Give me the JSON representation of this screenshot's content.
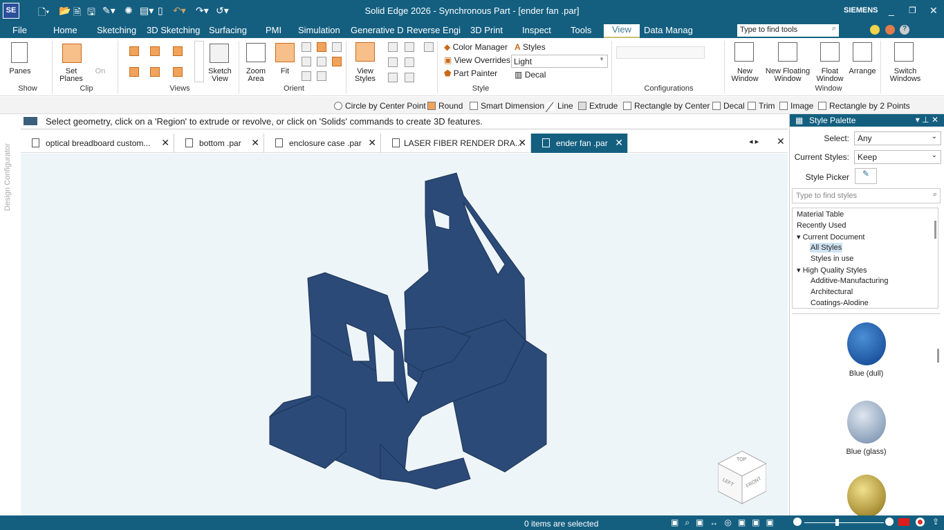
{
  "app": {
    "logo": "SE",
    "title": "Solid Edge 2026 - Synchronous Part - [ender fan .par]",
    "brand": "SIEMENS",
    "window_controls": [
      "_",
      "❐",
      "✕"
    ]
  },
  "menu_tabs": [
    "File",
    "Home",
    "Sketching",
    "3D Sketching",
    "Surfacing",
    "PMI",
    "Simulation",
    "Generative D",
    "Reverse Engi",
    "3D Print",
    "Inspect",
    "Tools",
    "View",
    "Data Manag"
  ],
  "active_tab": "View",
  "search_tools": {
    "placeholder": "Type to find tools"
  },
  "ribbon": {
    "show": {
      "panes": "Panes",
      "group": "Show"
    },
    "clip": {
      "set_planes": "Set Planes",
      "on": "On",
      "group": "Clip"
    },
    "views": {
      "sketch_view": "Sketch View",
      "group": "Views"
    },
    "orient": {
      "zoom_area": "Zoom Area",
      "fit": "Fit",
      "group": "Orient"
    },
    "view_styles": "View Styles",
    "style": {
      "color_manager": "Color Manager",
      "styles": "Styles",
      "view_overrides": "View Overrides",
      "override_value": "Light",
      "part_painter": "Part Painter",
      "decal": "Decal",
      "group": "Style"
    },
    "configurations": {
      "group": "Configurations"
    },
    "window": {
      "new_window": "New Window",
      "new_floating": "New Floating Window",
      "float_window": "Float Window",
      "arrange": "Arrange",
      "switch_windows": "Switch Windows",
      "group": "Window"
    }
  },
  "command_bar": [
    "Circle by Center Point",
    "Round",
    "Smart Dimension",
    "Line",
    "Extrude",
    "Rectangle by Center",
    "Decal",
    "Trim",
    "Image",
    "Rectangle by 2 Points"
  ],
  "prompt": "Select geometry, click on a 'Region' to extrude or revolve, or click on 'Solids' commands to create 3D features.",
  "side_label": "Design Configurator",
  "doc_tabs": [
    "optical breadboard custom...",
    "bottom .par",
    "enclosure case .par",
    "LASER FIBER RENDER DRA...",
    "ender fan .par"
  ],
  "view_cube": {
    "top": "TOP",
    "left": "LEFT",
    "front": "FRONT"
  },
  "style_palette": {
    "title": "Style Palette",
    "select_label": "Select:",
    "select_value": "Any",
    "current_label": "Current Styles:",
    "current_value": "Keep",
    "picker_label": "Style Picker",
    "search_placeholder": "Type to find styles",
    "tree": [
      "Material Table",
      "Recently Used",
      "Current Document",
      "All Styles",
      "Styles in use",
      "High Quality Styles",
      "Additive-Manufacturing",
      "Architectural",
      "Coatings-Alodine"
    ],
    "swatches": [
      "Blue (dull)",
      "Blue (glass)"
    ]
  },
  "status": {
    "text": "0 items are selected"
  },
  "colors": {
    "chrome": "#145f80",
    "model": "#2b4a78",
    "viewport": "#eef5f8"
  }
}
